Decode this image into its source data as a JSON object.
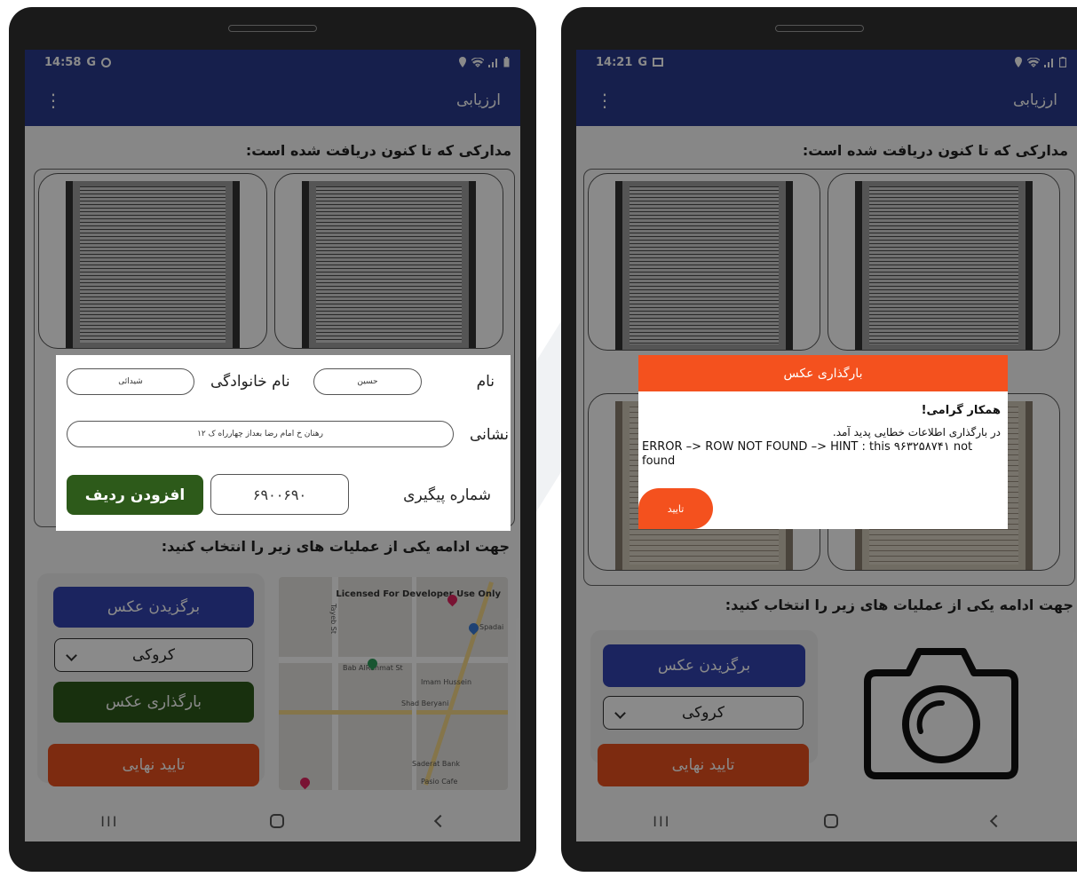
{
  "colors": {
    "primary": "#2a3a8c",
    "blue_button": "#3344b0",
    "green_button": "#2d5a1a",
    "orange": "#f4511e"
  },
  "left": {
    "status": {
      "time": "14:58",
      "glyphs": "G",
      "icons": [
        "location-icon",
        "wifi-icon",
        "signal-icon",
        "battery-icon"
      ]
    },
    "appbar": {
      "title": "ارزیابی",
      "menu": "⋮"
    },
    "docs_heading": "مدارکی که تا کنون دریافت شده است:",
    "ops_heading": "جهت ادامه یکی از عملیات های زیر را انتخاب کنید:",
    "choose_photo": "برگزیدن عکس",
    "select_value": "کروکی",
    "upload_photo": "بارگذاری عکس",
    "final_confirm": "تایید نهایی",
    "map": {
      "license": "Licensed For Developer Use Only",
      "labels": [
        "Tayeb St",
        "Bab AlRahmat St",
        "Imam Hussein",
        "Shad Beryani",
        "Saderat Bank",
        "Pasio Cafe",
        "Spadai"
      ]
    },
    "dialog": {
      "name_label": "نام",
      "name_value": "حسین",
      "family_label": "نام خانوادگی",
      "family_value": "شیدائی",
      "address_label": "نشانی",
      "address_value": "رهنان خ امام رضا بعداز چهارراه ک ۱۲",
      "tracking_label": "شماره پیگیری",
      "tracking_value": "۶۹۰۰۶۹۰",
      "add_row": "افزودن ردیف"
    }
  },
  "right": {
    "status": {
      "time": "14:21",
      "glyphs": "G",
      "icons": [
        "location-icon",
        "wifi-icon",
        "signal-icon",
        "battery-icon"
      ]
    },
    "appbar": {
      "title": "ارزیابی",
      "menu": "⋮"
    },
    "docs_heading": "مدارکی که تا کنون دریافت شده است:",
    "ops_heading": "جهت ادامه یکی از عملیات های زیر را انتخاب کنید:",
    "choose_photo": "برگزیدن عکس",
    "select_value": "کروکی",
    "final_confirm": "تایید نهایی",
    "alert": {
      "title": "بارگذاری عکس",
      "greeting": "همکار گرامی!",
      "message": "در بارگذاری اطلاعات خطایی پدید آمد.",
      "error": "ERROR –> ROW NOT FOUND –> HINT : this ۹۶۳۲۵۸۷۴۱ not found",
      "ok": "تایید"
    }
  }
}
